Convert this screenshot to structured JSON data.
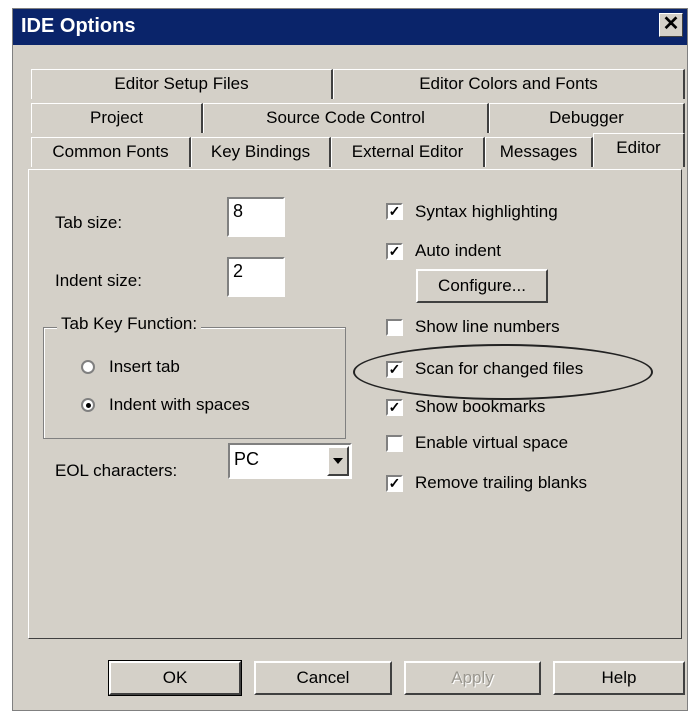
{
  "window": {
    "title": "IDE Options",
    "close_glyph": "✕"
  },
  "tabs": {
    "row1": [
      "Editor Setup Files",
      "Editor Colors and Fonts"
    ],
    "row2": [
      "Project",
      "Source Code Control",
      "Debugger"
    ],
    "row3": [
      "Common Fonts",
      "Key Bindings",
      "External Editor",
      "Messages",
      "Editor"
    ],
    "active": "Editor"
  },
  "editor": {
    "tab_size_label": "Tab size:",
    "tab_size_value": "8",
    "indent_size_label": "Indent size:",
    "indent_size_value": "2",
    "tab_key_group": {
      "legend": "Tab Key Function:",
      "options": [
        "Insert tab",
        "Indent with spaces"
      ],
      "selected": "Indent with spaces"
    },
    "eol_label": "EOL characters:",
    "eol_value": "PC",
    "checkboxes": [
      {
        "label": "Syntax highlighting",
        "checked": true
      },
      {
        "label": "Auto indent",
        "checked": true
      },
      {
        "label": "Show line numbers",
        "checked": false
      },
      {
        "label": "Scan for changed files",
        "checked": true
      },
      {
        "label": "Show bookmarks",
        "checked": true
      },
      {
        "label": "Enable virtual space",
        "checked": false
      },
      {
        "label": "Remove trailing blanks",
        "checked": true
      }
    ],
    "configure_button": "Configure..."
  },
  "footer": {
    "ok": "OK",
    "cancel": "Cancel",
    "apply": "Apply",
    "help": "Help"
  },
  "check_glyph": "✓",
  "colors": {
    "face": "#d4d0c8",
    "titlebar": "#0a246a"
  }
}
